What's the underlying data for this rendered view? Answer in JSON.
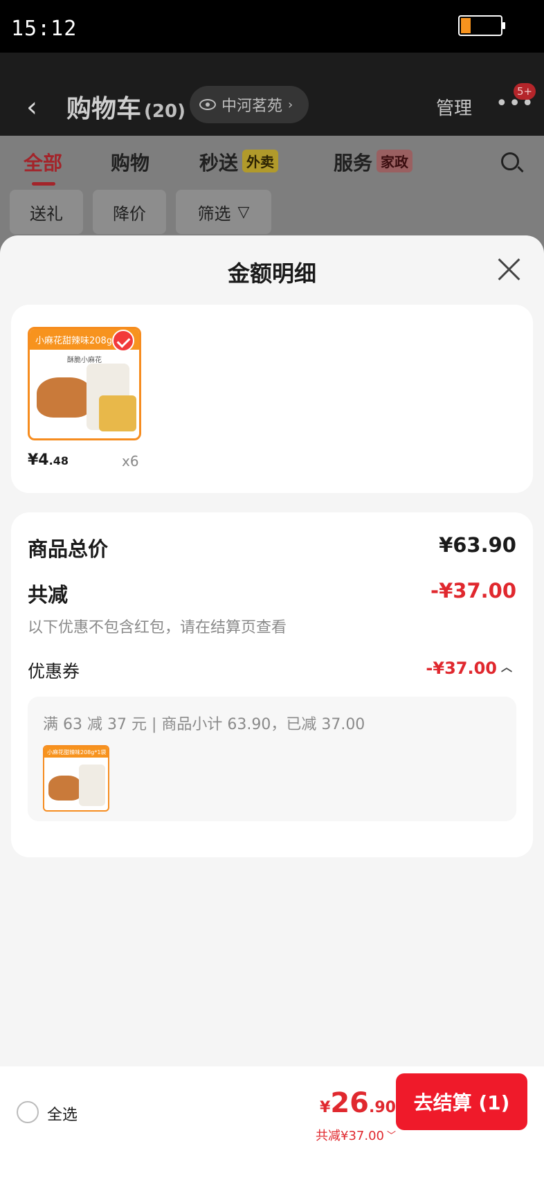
{
  "status": {
    "time": "15:12"
  },
  "header": {
    "title": "购物车",
    "count": "(20)",
    "location": "中河茗苑",
    "manage": "管理",
    "badge": "5+"
  },
  "tabs": [
    {
      "label": "全部",
      "active": true
    },
    {
      "label": "购物"
    },
    {
      "label": "秒送",
      "tag": "外卖"
    },
    {
      "label": "服务",
      "tag": "家政"
    }
  ],
  "chips": [
    "送礼",
    "降价",
    "筛选"
  ],
  "sheet": {
    "title": "金额明细",
    "product": {
      "banner": "小麻花甜辣味208g*1袋",
      "sub": "酥脆小麻花",
      "price_int": "¥4",
      "price_dec": ".48",
      "qty": "x6"
    },
    "summary": {
      "total_label": "商品总价",
      "total_value": "¥63.90",
      "reduce_label": "共减",
      "reduce_value": "-¥37.00",
      "note": "以下优惠不包含红包，请在结算页查看",
      "coupon_label": "优惠券",
      "coupon_value": "-¥37.00",
      "coupon_desc": "满 63 减 37 元 | 商品小计 63.90，已减 37.00"
    }
  },
  "bottom": {
    "select_all": "全选",
    "currency": "¥",
    "total_int": "26",
    "total_dec": ".90",
    "reduce_text": "共减¥37.00",
    "checkout": "去结算 (1)"
  },
  "colors": {
    "accent": "#ef1a2a",
    "price_red": "#e0282e",
    "product_orange": "#f7931e"
  }
}
